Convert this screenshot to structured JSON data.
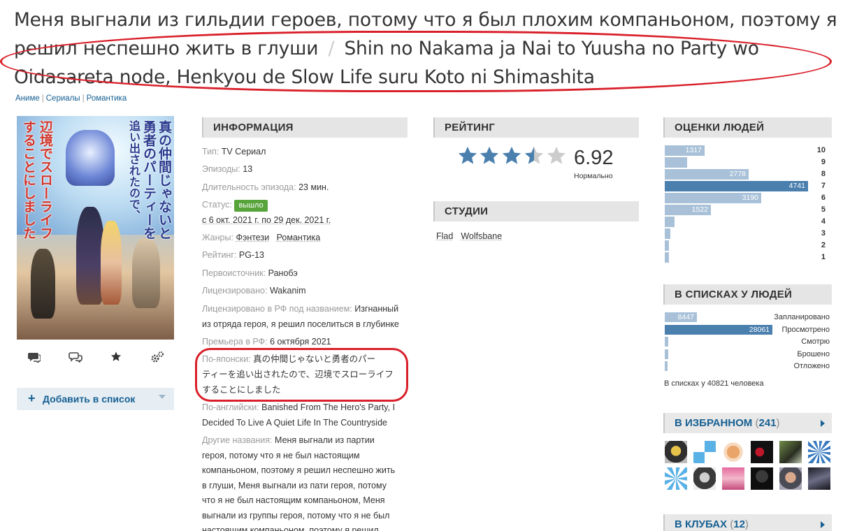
{
  "title": {
    "ru": "Меня выгнали из гильдии героев, потому что я был плохим компаньоном, поэтому я решил неспешно жить в глуши",
    "separator": "/",
    "romaji": "Shin no Nakama ja Nai to Yuusha no Party wo Oidasareta node, Henkyou de Slow Life suru Koto ni Shimashita"
  },
  "breadcrumbs": [
    "Аниме",
    "Сериалы",
    "Романтика"
  ],
  "poster": {
    "text_line1": "真の仲間じゃないと",
    "text_line2": "勇者のパーティーを",
    "text_line3": "追い出されたので、",
    "text_line4": "辺境でスローライフ",
    "text_line5": "することにしました"
  },
  "poster_actions": [
    "comment-icon",
    "discussion-icon",
    "star-icon",
    "gears-icon"
  ],
  "add_to_list": {
    "label": "Добавить в список",
    "plus": "+"
  },
  "info": {
    "header": "ИНФОРМАЦИЯ",
    "type_k": "Тип:",
    "type_v": "TV Сериал",
    "episodes_k": "Эпизоды:",
    "episodes_v": "13",
    "duration_k": "Длительность эпизода:",
    "duration_v": "23 мин.",
    "status_k": "Статус:",
    "status_v": "вышло",
    "dates": "с 6 окт. 2021 г. по 29 дек. 2021 г.",
    "genres_k": "Жанры:",
    "genre1": "Фэнтези",
    "genre2": "Романтика",
    "rating_k": "Рейтинг:",
    "rating_v": "PG-13",
    "source_k": "Первоисточник:",
    "source_v": "Ранобэ",
    "licensed_k": "Лицензировано:",
    "licensed_v": "Wakanim",
    "licensed_rf_k": "Лицензировано в РФ под названием:",
    "licensed_rf_v1": "Изгнанный",
    "licensed_rf_v2": "из отряда героя, я решил поселиться в глубинке",
    "premiere_k": "Премьера в РФ:",
    "premiere_v": "6 октября 2021",
    "japanese_k": "По-японски:",
    "japanese_v1": "真の仲間じゃないと勇者のパー",
    "japanese_v2": "ティーを追い出されたので、辺境でスローライフ",
    "japanese_v3": "することにしました",
    "english_k": "По-английски:",
    "english_v1": "Banished From The Hero's Party, I",
    "english_v2": "Decided To Live A Quiet Life In The Countryside",
    "other_k": "Другие названия:",
    "other_v1": "Меня выгнали из партии",
    "other_v2": "героя, потому что я не был настоящим",
    "other_v3": "компаньоном, поэтому я решил неспешно жить",
    "other_v4": "в глуши, Меня выгнали из пати героя, потому",
    "other_v5": "что я не был настоящим компаньоном, Меня",
    "other_v6": "выгнали из группы героя, потому что я не был",
    "other_v7": "настоящим компаньоном, поэтому я решил"
  },
  "rating": {
    "header": "РЕЙТИНГ",
    "score": "6.92",
    "label": "Нормально",
    "stars_value": 3.5,
    "stars_max": 5,
    "star_color": "#4a7fae",
    "empty_color": "#cccccc"
  },
  "studios": {
    "header": "СТУДИИ",
    "items": [
      "Flad",
      "Wolfsbane"
    ]
  },
  "scores": {
    "header": "ОЦЕНКИ ЛЮДЕЙ",
    "rows": [
      {
        "score": "10",
        "count": 1317,
        "label": "1317"
      },
      {
        "score": "9",
        "count": 750,
        "label": ""
      },
      {
        "score": "8",
        "count": 2778,
        "label": "2778"
      },
      {
        "score": "7",
        "count": 4741,
        "label": "4741"
      },
      {
        "score": "6",
        "count": 3190,
        "label": "3190"
      },
      {
        "score": "5",
        "count": 1522,
        "label": "1522"
      },
      {
        "score": "4",
        "count": 330,
        "label": ""
      },
      {
        "score": "3",
        "count": 175,
        "label": ""
      },
      {
        "score": "2",
        "count": 95,
        "label": ""
      },
      {
        "score": "1",
        "count": 95,
        "label": ""
      }
    ]
  },
  "lists": {
    "header": "В СПИСКАХ У ЛЮДЕЙ",
    "rows": [
      {
        "name": "Запланировано",
        "count": 8447,
        "label": "8447"
      },
      {
        "name": "Просмотрено",
        "count": 28061,
        "label": "28061"
      },
      {
        "name": "Смотрю",
        "count": 1000,
        "label": ""
      },
      {
        "name": "Брошено",
        "count": 850,
        "label": ""
      },
      {
        "name": "Отложено",
        "count": 300,
        "label": ""
      }
    ],
    "total": "В списках у 40821 человека"
  },
  "favorites": {
    "header": "В ИЗБРАННОМ",
    "count": "241",
    "open": "(",
    "close": ")"
  },
  "clubs": {
    "header": "В КЛУБАХ",
    "count": "12",
    "open": "(",
    "close": ")"
  },
  "colors": {
    "accent": "#176093",
    "bar": "#a8c1d8",
    "bar_hi": "#4a7fae",
    "status": "#57a43b",
    "highlight": "#d9202a"
  }
}
